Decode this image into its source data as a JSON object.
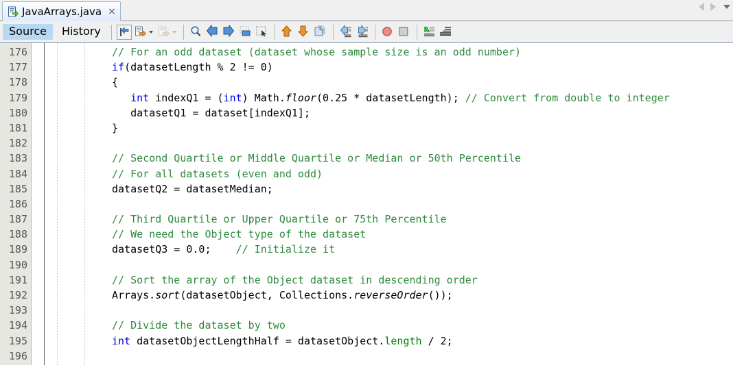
{
  "window": {
    "tab": {
      "label": "JavaArrays.java",
      "icon": "java-file-icon",
      "close_label": "×"
    },
    "tab_nav": {
      "scroll_left": "scroll-tabs-left",
      "scroll_right": "scroll-tabs-right",
      "tab_list": "tab-list-dropdown"
    }
  },
  "view_tabs": [
    {
      "label": "Source",
      "active": true
    },
    {
      "label": "History",
      "active": false
    }
  ],
  "toolbar": {
    "groups": [
      {
        "buttons": [
          {
            "name": "last-edit-icon"
          },
          {
            "name": "toggle-comment-icon",
            "has_dropdown": true
          },
          {
            "name": "shift-right-icon",
            "has_dropdown": true,
            "disabled": true
          }
        ]
      },
      {
        "buttons": [
          {
            "name": "find-selection-icon"
          },
          {
            "name": "previous-bookmark-icon"
          },
          {
            "name": "next-bookmark-icon"
          },
          {
            "name": "toggle-bookmark-icon"
          },
          {
            "name": "rectangular-selection-icon"
          }
        ]
      },
      {
        "buttons": [
          {
            "name": "previous-error-icon"
          },
          {
            "name": "next-error-icon"
          },
          {
            "name": "shift-line-left-icon"
          }
        ]
      },
      {
        "buttons": [
          {
            "name": "shift-left-icon"
          },
          {
            "name": "shift-right-indent-icon"
          }
        ]
      },
      {
        "buttons": [
          {
            "name": "toggle-breakpoint-icon"
          },
          {
            "name": "stop-icon"
          }
        ]
      },
      {
        "buttons": [
          {
            "name": "format-icon"
          },
          {
            "name": "inspect-icon"
          }
        ]
      }
    ]
  },
  "editor": {
    "first_line_number": 176,
    "line_numbers": [
      176,
      177,
      178,
      179,
      180,
      181,
      182,
      183,
      184,
      185,
      186,
      187,
      188,
      189,
      190,
      191,
      192,
      193,
      194,
      195,
      196
    ],
    "colors": {
      "comment": "#2e8b3d",
      "keyword": "#0000e6",
      "plain": "#000000",
      "field": "#008000",
      "background": "#ffffff",
      "gutter_background": "#e7e7e2",
      "gutter_text": "#555555"
    },
    "lines": [
      {
        "n": 176,
        "tokens": [
          {
            "t": "cm",
            "s": "// For an odd dataset (dataset whose sample size is an odd number)"
          }
        ]
      },
      {
        "n": 177,
        "tokens": [
          {
            "t": "kw",
            "s": "if"
          },
          {
            "t": "pl",
            "s": "(datasetLength % 2 != 0)"
          }
        ]
      },
      {
        "n": 178,
        "tokens": [
          {
            "t": "pl",
            "s": "{"
          }
        ]
      },
      {
        "n": 179,
        "tokens": [
          {
            "t": "pl",
            "s": "   "
          },
          {
            "t": "kw",
            "s": "int"
          },
          {
            "t": "pl",
            "s": " indexQ1 = ("
          },
          {
            "t": "kw",
            "s": "int"
          },
          {
            "t": "pl",
            "s": ") Math."
          },
          {
            "t": "mth",
            "s": "floor"
          },
          {
            "t": "pl",
            "s": "(0.25 * datasetLength); "
          },
          {
            "t": "cm",
            "s": "// Convert from double to integer"
          }
        ]
      },
      {
        "n": 180,
        "tokens": [
          {
            "t": "pl",
            "s": "   datasetQ1 = dataset[indexQ1];"
          }
        ]
      },
      {
        "n": 181,
        "tokens": [
          {
            "t": "pl",
            "s": "}"
          }
        ]
      },
      {
        "n": 182,
        "tokens": []
      },
      {
        "n": 183,
        "tokens": [
          {
            "t": "cm",
            "s": "// Second Quartile or Middle Quartile or Median or 50th Percentile"
          }
        ]
      },
      {
        "n": 184,
        "tokens": [
          {
            "t": "cm",
            "s": "// For all datasets (even and odd)"
          }
        ]
      },
      {
        "n": 185,
        "tokens": [
          {
            "t": "pl",
            "s": "datasetQ2 = datasetMedian;"
          }
        ]
      },
      {
        "n": 186,
        "tokens": []
      },
      {
        "n": 187,
        "tokens": [
          {
            "t": "cm",
            "s": "// Third Quartile or Upper Quartile or 75th Percentile"
          }
        ]
      },
      {
        "n": 188,
        "tokens": [
          {
            "t": "cm",
            "s": "// We need the Object type of the dataset"
          }
        ]
      },
      {
        "n": 189,
        "tokens": [
          {
            "t": "pl",
            "s": "datasetQ3 = 0.0;    "
          },
          {
            "t": "cm",
            "s": "// Initialize it"
          }
        ]
      },
      {
        "n": 190,
        "tokens": []
      },
      {
        "n": 191,
        "tokens": [
          {
            "t": "cm",
            "s": "// Sort the array of the Object dataset in descending order"
          }
        ]
      },
      {
        "n": 192,
        "tokens": [
          {
            "t": "pl",
            "s": "Arrays."
          },
          {
            "t": "mth",
            "s": "sort"
          },
          {
            "t": "pl",
            "s": "(datasetObject, Collections."
          },
          {
            "t": "mth",
            "s": "reverseOrder"
          },
          {
            "t": "pl",
            "s": "());"
          }
        ]
      },
      {
        "n": 193,
        "tokens": []
      },
      {
        "n": 194,
        "tokens": [
          {
            "t": "cm",
            "s": "// Divide the dataset by two"
          }
        ]
      },
      {
        "n": 195,
        "tokens": [
          {
            "t": "kw",
            "s": "int"
          },
          {
            "t": "pl",
            "s": " datasetObjectLengthHalf = datasetObject."
          },
          {
            "t": "fld",
            "s": "length"
          },
          {
            "t": "pl",
            "s": " / 2;"
          }
        ]
      },
      {
        "n": 196,
        "tokens": []
      }
    ]
  }
}
